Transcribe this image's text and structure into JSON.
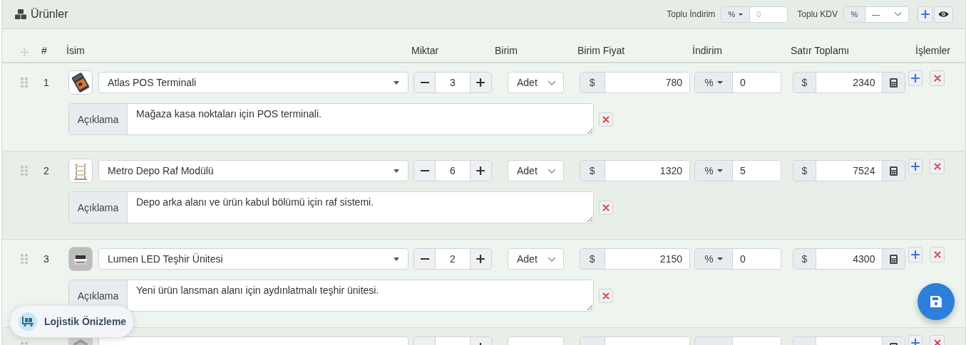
{
  "panel": {
    "title": "Ürünler"
  },
  "bulk": {
    "discount_label": "Toplu İndirim",
    "discount_type": "%",
    "discount_placeholder": "0",
    "vat_label": "Toplu KDV",
    "vat_type": "%",
    "vat_value": "—"
  },
  "columns": [
    "#",
    "İsim",
    "Miktar",
    "Birim",
    "Birim Fiyat",
    "İndirim",
    "Satır Toplamı",
    "İşlemler"
  ],
  "rows": [
    {
      "number": "1",
      "name": "Atlas POS Terminali",
      "quantity": "3",
      "unit": "Adet",
      "currency": "$",
      "price": "780",
      "discount_type": "%",
      "discount": "0",
      "total_currency": "$",
      "total": "2340",
      "description_label": "Açıklama",
      "description": "Mağaza kasa noktaları için POS terminali."
    },
    {
      "number": "2",
      "name": "Metro Depo Raf Modülü",
      "quantity": "6",
      "unit": "Adet",
      "currency": "$",
      "price": "1320",
      "discount_type": "%",
      "discount": "5",
      "total_currency": "$",
      "total": "7524",
      "description_label": "Açıklama",
      "description": "Depo arka alanı ve ürün kabul bölümü için raf sistemi."
    },
    {
      "number": "3",
      "name": "Lumen LED Teşhir Ünitesi",
      "quantity": "2",
      "unit": "Adet",
      "currency": "$",
      "price": "2150",
      "discount_type": "%",
      "discount": "0",
      "total_currency": "$",
      "total": "4300",
      "description_label": "Açıklama",
      "description": "Yeni ürün lansman alanı için aydınlatmalı teşhir ünitesi."
    }
  ],
  "more_rows_below": true,
  "logistics_button": {
    "label": "Lojistik Önizleme"
  }
}
